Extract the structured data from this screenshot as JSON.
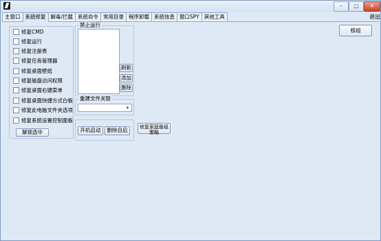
{
  "window": {
    "controls": {
      "minimize": "–",
      "maximize": "□",
      "close": "✕"
    },
    "exit_label": "退出"
  },
  "tabs": [
    "主窗口",
    "系统修复",
    "解毒/拦截",
    "系统命令",
    "常用目录",
    "程序卸载",
    "系统信息",
    "窗口SPY",
    "其他工具"
  ],
  "active_tab_index": 1,
  "repair": {
    "items": [
      "修复CMD",
      "修复运行",
      "修复注册表",
      "修复任务管理器",
      "修复桌面壁纸",
      "修复磁盘访问权限",
      "修复桌面右键菜单",
      "修复桌面快捷方式白板",
      "修复此电脑文件夹选项",
      "修复系统设置控制面板"
    ],
    "unlock_button": "解锁选中"
  },
  "forbid_run": {
    "title": "禁止运行",
    "refresh_button": "刷新",
    "add_button": "添加",
    "delete_button": "删除"
  },
  "file_assoc": {
    "title": "重建文件关联",
    "selected": ""
  },
  "startup": {
    "startup_button": "开机启动",
    "remove_button": "删除自启"
  },
  "group_policy_button": "修复家庭版组策略",
  "top_right_button": "核组",
  "colors": {
    "background": "#dfe9f5",
    "border": "#8ea8c8"
  }
}
